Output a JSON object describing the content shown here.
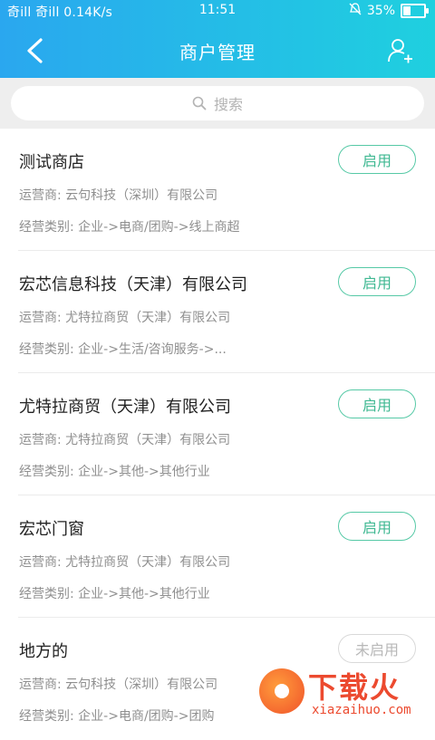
{
  "status_bar": {
    "left": "奇ill 奇ill 0.14K/s",
    "time": "11:51",
    "battery_percent": "35%",
    "battery_level": 0.35
  },
  "nav": {
    "title": "商户管理"
  },
  "search": {
    "placeholder": "搜索"
  },
  "merchants": [
    {
      "name": "测试商店",
      "operator": "运营商: 云句科技（深圳）有限公司",
      "category": "经营类别: 企业->电商/团购->线上商超",
      "status": "启用",
      "enabled": true
    },
    {
      "name": "宏芯信息科技（天津）有限公司",
      "operator": "运营商: 尤特拉商贸（天津）有限公司",
      "category": "经营类别: 企业->生活/咨询服务->...",
      "status": "启用",
      "enabled": true
    },
    {
      "name": "尤特拉商贸（天津）有限公司",
      "operator": "运营商: 尤特拉商贸（天津）有限公司",
      "category": "经营类别: 企业->其他->其他行业",
      "status": "启用",
      "enabled": true
    },
    {
      "name": "宏芯门窗",
      "operator": "运营商: 尤特拉商贸（天津）有限公司",
      "category": "经营类别: 企业->其他->其他行业",
      "status": "启用",
      "enabled": true
    },
    {
      "name": "地方的",
      "operator": "运营商: 云句科技（深圳）有限公司",
      "category": "经营类别: 企业->电商/团购->团购",
      "status": "未启用",
      "enabled": false
    }
  ],
  "watermark": {
    "title": "下载火",
    "subtitle": "xiazaihuo.com"
  },
  "colors": {
    "header_gradient_start": "#2aa7ef",
    "header_gradient_end": "#1fd0df",
    "enabled_accent": "#56c9a6",
    "disabled_accent": "#d9d9d9"
  }
}
